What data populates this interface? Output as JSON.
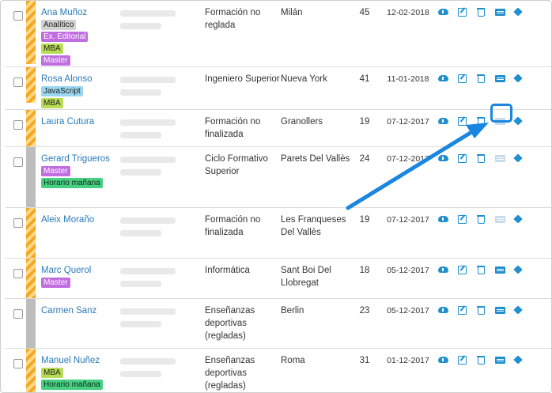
{
  "rows": [
    {
      "name": "Ana Muñoz",
      "stripe": "orange",
      "tags": [
        {
          "text": "Analítico",
          "color": "gray"
        },
        {
          "text": "Ex. Editorial",
          "color": "purple"
        },
        {
          "text": "MBA",
          "color": "lime"
        },
        {
          "text": "Master",
          "color": "purple"
        }
      ],
      "education": "Formación no reglada",
      "city": "Milán",
      "age": "45",
      "date": "12-02-2018",
      "card_dim": false
    },
    {
      "name": "Rosa Alonso",
      "stripe": "orange",
      "tags": [
        {
          "text": "JavaScript",
          "color": "cyan"
        },
        {
          "text": "MBA",
          "color": "lime"
        }
      ],
      "education": "Ingeniero Superior",
      "city": "Nueva York",
      "age": "41",
      "date": "11-01-2018",
      "card_dim": false
    },
    {
      "name": "Laura Cutura",
      "stripe": "orange",
      "tags": [],
      "education": "Formación no finalizada",
      "city": "Granollers",
      "age": "19",
      "date": "07-12-2017",
      "card_dim": true
    },
    {
      "name": "Gerard Trigueros",
      "stripe": "gray",
      "tags": [
        {
          "text": "Master",
          "color": "purple"
        },
        {
          "text": "Horario mañana",
          "color": "green"
        }
      ],
      "education": "Ciclo Formativo Superior",
      "city": "Parets Del Vallès",
      "age": "24",
      "date": "07-12-2017",
      "card_dim": true
    },
    {
      "name": "Aleix Moraño",
      "stripe": "orange",
      "tags": [],
      "education": "Formación no finalizada",
      "city": "Les Franqueses Del Vallès",
      "age": "19",
      "date": "07-12-2017",
      "card_dim": true
    },
    {
      "name": "Marc Querol",
      "stripe": "orange",
      "tags": [
        {
          "text": "Master",
          "color": "purple"
        }
      ],
      "education": "Informática",
      "city": "Sant Boi Del Llobregat",
      "age": "18",
      "date": "05-12-2017",
      "card_dim": false
    },
    {
      "name": "Carmen Sanz",
      "stripe": "gray",
      "tags": [],
      "education": "Enseñanzas deportivas (regladas)",
      "city": "Berlin",
      "age": "23",
      "date": "05-12-2017",
      "card_dim": false
    },
    {
      "name": "Manuel Nuñez",
      "stripe": "orange",
      "tags": [
        {
          "text": "MBA",
          "color": "lime"
        },
        {
          "text": "Horario mañana",
          "color": "green"
        }
      ],
      "education": "Enseñanzas deportivas (regladas)",
      "city": "Roma",
      "age": "31",
      "date": "01-12-2017",
      "card_dim": false
    }
  ],
  "icons": [
    "download-icon",
    "edit-icon",
    "trash-icon",
    "card-icon",
    "tag-icon"
  ],
  "colors": {
    "link": "#2a7ab8",
    "icon": "#1f8fd0",
    "highlight": "#1a86e0"
  }
}
